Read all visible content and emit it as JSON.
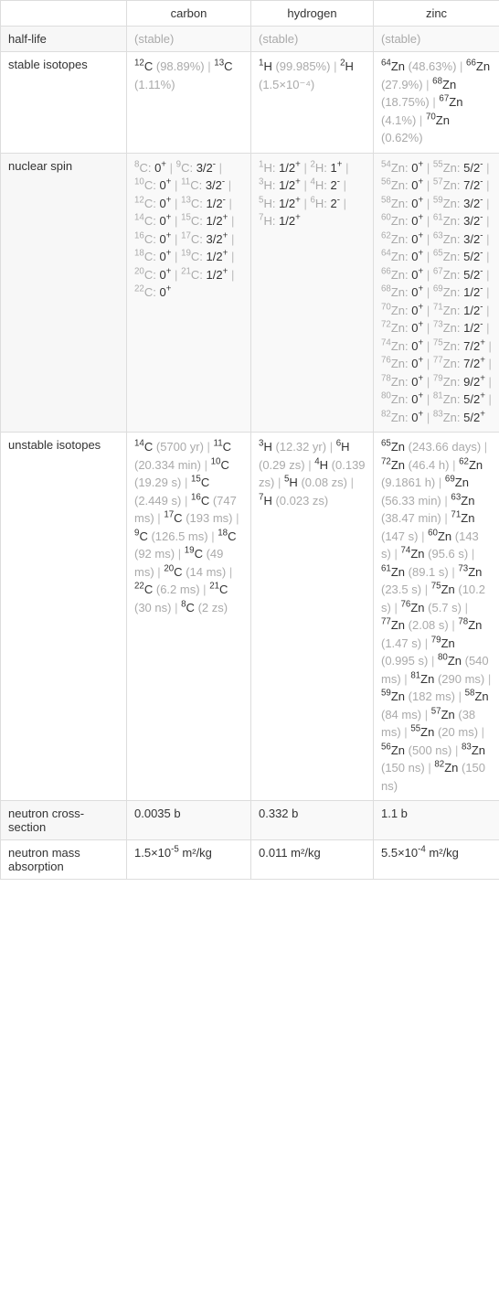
{
  "headers": {
    "h1": "carbon",
    "h2": "hydrogen",
    "h3": "zinc"
  },
  "rows": {
    "half_life": {
      "label": "half-life",
      "c": "(stable)",
      "h": "(stable)",
      "z": "(stable)"
    },
    "stable_isotopes": {
      "label": "stable isotopes",
      "c": [
        {
          "a": "12",
          "s": "C",
          "p": "(98.89%)"
        },
        {
          "a": "13",
          "s": "C",
          "p": "(1.11%)"
        }
      ],
      "h": [
        {
          "a": "1",
          "s": "H",
          "p": "(99.985%)"
        },
        {
          "a": "2",
          "s": "H",
          "p": "(1.5×10⁻⁴)"
        }
      ],
      "z": [
        {
          "a": "64",
          "s": "Zn",
          "p": "(48.63%)"
        },
        {
          "a": "66",
          "s": "Zn",
          "p": "(27.9%)"
        },
        {
          "a": "68",
          "s": "Zn",
          "p": "(18.75%)"
        },
        {
          "a": "67",
          "s": "Zn",
          "p": "(4.1%)"
        },
        {
          "a": "70",
          "s": "Zn",
          "p": "(0.62%)"
        }
      ]
    },
    "nuclear_spin": {
      "label": "nuclear spin",
      "c": [
        {
          "a": "8",
          "s": "C",
          "spin": "0",
          "sign": "+"
        },
        {
          "a": "9",
          "s": "C",
          "spin": "3/2",
          "sign": "-"
        },
        {
          "a": "10",
          "s": "C",
          "spin": "0",
          "sign": "+"
        },
        {
          "a": "11",
          "s": "C",
          "spin": "3/2",
          "sign": "-"
        },
        {
          "a": "12",
          "s": "C",
          "spin": "0",
          "sign": "+"
        },
        {
          "a": "13",
          "s": "C",
          "spin": "1/2",
          "sign": "-"
        },
        {
          "a": "14",
          "s": "C",
          "spin": "0",
          "sign": "+"
        },
        {
          "a": "15",
          "s": "C",
          "spin": "1/2",
          "sign": "+"
        },
        {
          "a": "16",
          "s": "C",
          "spin": "0",
          "sign": "+"
        },
        {
          "a": "17",
          "s": "C",
          "spin": "3/2",
          "sign": "+"
        },
        {
          "a": "18",
          "s": "C",
          "spin": "0",
          "sign": "+"
        },
        {
          "a": "19",
          "s": "C",
          "spin": "1/2",
          "sign": "+"
        },
        {
          "a": "20",
          "s": "C",
          "spin": "0",
          "sign": "+"
        },
        {
          "a": "21",
          "s": "C",
          "spin": "1/2",
          "sign": "+"
        },
        {
          "a": "22",
          "s": "C",
          "spin": "0",
          "sign": "+"
        }
      ],
      "h": [
        {
          "a": "1",
          "s": "H",
          "spin": "1/2",
          "sign": "+"
        },
        {
          "a": "2",
          "s": "H",
          "spin": "1",
          "sign": "+"
        },
        {
          "a": "3",
          "s": "H",
          "spin": "1/2",
          "sign": "+"
        },
        {
          "a": "4",
          "s": "H",
          "spin": "2",
          "sign": "-"
        },
        {
          "a": "5",
          "s": "H",
          "spin": "1/2",
          "sign": "+"
        },
        {
          "a": "6",
          "s": "H",
          "spin": "2",
          "sign": "-"
        },
        {
          "a": "7",
          "s": "H",
          "spin": "1/2",
          "sign": "+"
        }
      ],
      "z": [
        {
          "a": "54",
          "s": "Zn",
          "spin": "0",
          "sign": "+"
        },
        {
          "a": "55",
          "s": "Zn",
          "spin": "5/2",
          "sign": "-"
        },
        {
          "a": "56",
          "s": "Zn",
          "spin": "0",
          "sign": "+"
        },
        {
          "a": "57",
          "s": "Zn",
          "spin": "7/2",
          "sign": "-"
        },
        {
          "a": "58",
          "s": "Zn",
          "spin": "0",
          "sign": "+"
        },
        {
          "a": "59",
          "s": "Zn",
          "spin": "3/2",
          "sign": "-"
        },
        {
          "a": "60",
          "s": "Zn",
          "spin": "0",
          "sign": "+"
        },
        {
          "a": "61",
          "s": "Zn",
          "spin": "3/2",
          "sign": "-"
        },
        {
          "a": "62",
          "s": "Zn",
          "spin": "0",
          "sign": "+"
        },
        {
          "a": "63",
          "s": "Zn",
          "spin": "3/2",
          "sign": "-"
        },
        {
          "a": "64",
          "s": "Zn",
          "spin": "0",
          "sign": "+"
        },
        {
          "a": "65",
          "s": "Zn",
          "spin": "5/2",
          "sign": "-"
        },
        {
          "a": "66",
          "s": "Zn",
          "spin": "0",
          "sign": "+"
        },
        {
          "a": "67",
          "s": "Zn",
          "spin": "5/2",
          "sign": "-"
        },
        {
          "a": "68",
          "s": "Zn",
          "spin": "0",
          "sign": "+"
        },
        {
          "a": "69",
          "s": "Zn",
          "spin": "1/2",
          "sign": "-"
        },
        {
          "a": "70",
          "s": "Zn",
          "spin": "0",
          "sign": "+"
        },
        {
          "a": "71",
          "s": "Zn",
          "spin": "1/2",
          "sign": "-"
        },
        {
          "a": "72",
          "s": "Zn",
          "spin": "0",
          "sign": "+"
        },
        {
          "a": "73",
          "s": "Zn",
          "spin": "1/2",
          "sign": "-"
        },
        {
          "a": "74",
          "s": "Zn",
          "spin": "0",
          "sign": "+"
        },
        {
          "a": "75",
          "s": "Zn",
          "spin": "7/2",
          "sign": "+"
        },
        {
          "a": "76",
          "s": "Zn",
          "spin": "0",
          "sign": "+"
        },
        {
          "a": "77",
          "s": "Zn",
          "spin": "7/2",
          "sign": "+"
        },
        {
          "a": "78",
          "s": "Zn",
          "spin": "0",
          "sign": "+"
        },
        {
          "a": "79",
          "s": "Zn",
          "spin": "9/2",
          "sign": "+"
        },
        {
          "a": "80",
          "s": "Zn",
          "spin": "0",
          "sign": "+"
        },
        {
          "a": "81",
          "s": "Zn",
          "spin": "5/2",
          "sign": "+"
        },
        {
          "a": "82",
          "s": "Zn",
          "spin": "0",
          "sign": "+"
        },
        {
          "a": "83",
          "s": "Zn",
          "spin": "5/2",
          "sign": "+"
        }
      ]
    },
    "unstable_isotopes": {
      "label": "unstable isotopes",
      "c": [
        {
          "a": "14",
          "s": "C",
          "p": "(5700 yr)"
        },
        {
          "a": "11",
          "s": "C",
          "p": "(20.334 min)"
        },
        {
          "a": "10",
          "s": "C",
          "p": "(19.29 s)"
        },
        {
          "a": "15",
          "s": "C",
          "p": "(2.449 s)"
        },
        {
          "a": "16",
          "s": "C",
          "p": "(747 ms)"
        },
        {
          "a": "17",
          "s": "C",
          "p": "(193 ms)"
        },
        {
          "a": "9",
          "s": "C",
          "p": "(126.5 ms)"
        },
        {
          "a": "18",
          "s": "C",
          "p": "(92 ms)"
        },
        {
          "a": "19",
          "s": "C",
          "p": "(49 ms)"
        },
        {
          "a": "20",
          "s": "C",
          "p": "(14 ms)"
        },
        {
          "a": "22",
          "s": "C",
          "p": "(6.2 ms)"
        },
        {
          "a": "21",
          "s": "C",
          "p": "(30 ns)"
        },
        {
          "a": "8",
          "s": "C",
          "p": "(2 zs)"
        }
      ],
      "h": [
        {
          "a": "3",
          "s": "H",
          "p": "(12.32 yr)"
        },
        {
          "a": "6",
          "s": "H",
          "p": "(0.29 zs)"
        },
        {
          "a": "4",
          "s": "H",
          "p": "(0.139 zs)"
        },
        {
          "a": "5",
          "s": "H",
          "p": "(0.08 zs)"
        },
        {
          "a": "7",
          "s": "H",
          "p": "(0.023 zs)"
        }
      ],
      "z": [
        {
          "a": "65",
          "s": "Zn",
          "p": "(243.66 days)"
        },
        {
          "a": "72",
          "s": "Zn",
          "p": "(46.4 h)"
        },
        {
          "a": "62",
          "s": "Zn",
          "p": "(9.1861 h)"
        },
        {
          "a": "69",
          "s": "Zn",
          "p": "(56.33 min)"
        },
        {
          "a": "63",
          "s": "Zn",
          "p": "(38.47 min)"
        },
        {
          "a": "71",
          "s": "Zn",
          "p": "(147 s)"
        },
        {
          "a": "60",
          "s": "Zn",
          "p": "(143 s)"
        },
        {
          "a": "74",
          "s": "Zn",
          "p": "(95.6 s)"
        },
        {
          "a": "61",
          "s": "Zn",
          "p": "(89.1 s)"
        },
        {
          "a": "73",
          "s": "Zn",
          "p": "(23.5 s)"
        },
        {
          "a": "75",
          "s": "Zn",
          "p": "(10.2 s)"
        },
        {
          "a": "76",
          "s": "Zn",
          "p": "(5.7 s)"
        },
        {
          "a": "77",
          "s": "Zn",
          "p": "(2.08 s)"
        },
        {
          "a": "78",
          "s": "Zn",
          "p": "(1.47 s)"
        },
        {
          "a": "79",
          "s": "Zn",
          "p": "(0.995 s)"
        },
        {
          "a": "80",
          "s": "Zn",
          "p": "(540 ms)"
        },
        {
          "a": "81",
          "s": "Zn",
          "p": "(290 ms)"
        },
        {
          "a": "59",
          "s": "Zn",
          "p": "(182 ms)"
        },
        {
          "a": "58",
          "s": "Zn",
          "p": "(84 ms)"
        },
        {
          "a": "57",
          "s": "Zn",
          "p": "(38 ms)"
        },
        {
          "a": "55",
          "s": "Zn",
          "p": "(20 ms)"
        },
        {
          "a": "56",
          "s": "Zn",
          "p": "(500 ns)"
        },
        {
          "a": "83",
          "s": "Zn",
          "p": "(150 ns)"
        },
        {
          "a": "82",
          "s": "Zn",
          "p": "(150 ns)"
        }
      ]
    },
    "neutron_cross_section": {
      "label": "neutron cross-section",
      "c": "0.0035 b",
      "h": "0.332 b",
      "z": "1.1 b"
    },
    "neutron_mass_absorption": {
      "label": "neutron mass absorption",
      "c": {
        "coef": "1.5×10",
        "exp": "-5",
        "unit": " m²/kg"
      },
      "h": {
        "plain": "0.011 m²/kg"
      },
      "z": {
        "coef": "5.5×10",
        "exp": "-4",
        "unit": " m²/kg"
      }
    }
  }
}
